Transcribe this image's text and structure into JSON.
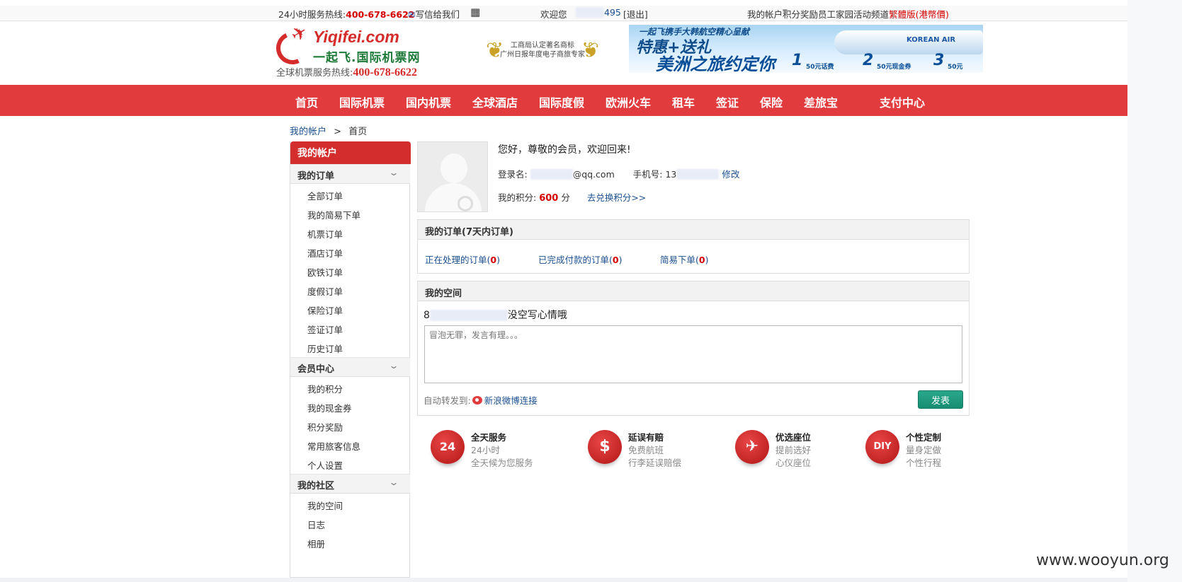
{
  "topbar": {
    "hotline_label": "24小时服务热线:",
    "hotline_number": "400-678-6622",
    "mail_link": "写信给我们",
    "welcome": "欢迎您",
    "username_tail": "495",
    "logout": "[退出]",
    "links": [
      "我的帐户",
      "积分奖励",
      "员工家园",
      "活动频道"
    ],
    "traditional": "繁體版(港幣價)"
  },
  "header": {
    "brand": "Yiqifei.com",
    "brand_sub": "一起飞.国际机票网",
    "hotline_label": "全球机票服务热线:",
    "hotline_number": "400-678-6622",
    "award_line1": "工商局认定著名商标",
    "award_line2": "广州日报年度电子商旅专家",
    "banner": {
      "line1": "一起飞携手大韩航空精心呈献",
      "line2": "特惠+送礼",
      "line3": "美洲之旅约定你",
      "airline": "KOREAN AIR",
      "coupons": [
        "50元话费",
        "50元现金券",
        "50元"
      ]
    }
  },
  "nav": {
    "items": [
      "首页",
      "国际机票",
      "国内机票",
      "全球酒店",
      "国际度假",
      "欧洲火车",
      "租车",
      "签证",
      "保险",
      "差旅宝",
      "支付中心"
    ]
  },
  "breadcrumb": {
    "root": "我的帐户",
    "sep": ">",
    "current": "首页"
  },
  "sidebar": {
    "title": "我的帐户",
    "sections": [
      {
        "label": "我的订单",
        "items": [
          "全部订单",
          "我的简易下单",
          "机票订单",
          "酒店订单",
          "欧铁订单",
          "度假订单",
          "保险订单",
          "签证订单",
          "历史订单"
        ]
      },
      {
        "label": "会员中心",
        "items": [
          "我的积分",
          "我的现金券",
          "积分奖励",
          "常用旅客信息",
          "个人设置"
        ]
      },
      {
        "label": "我的社区",
        "items": [
          "我的空间",
          "日志",
          "相册"
        ]
      }
    ]
  },
  "profile": {
    "greeting": "您好，尊敬的会员，欢迎回来!",
    "login_label": "登录名:",
    "login_value": "@qq.com",
    "phone_label": "手机号:",
    "phone_value": "13",
    "edit_link": "修改",
    "points_label": "我的积分:",
    "points_value": "600",
    "points_unit": "分",
    "exchange_link": "去兑换积分>>"
  },
  "orders": {
    "title": "我的订单(7天内订单)",
    "items": [
      {
        "label": "正在处理的订单",
        "count": "0"
      },
      {
        "label": "已完成付款的订单",
        "count": "0"
      },
      {
        "label": "简易下单",
        "count": "0"
      }
    ]
  },
  "space": {
    "title": "我的空间",
    "status_prefix": "8",
    "status_text": "没空写心情哦",
    "placeholder": "冒泡无罪，发言有理。。。",
    "forward_label": "自动转发到:",
    "weibo_link": "新浪微博连接",
    "submit": "发表"
  },
  "features": [
    {
      "icon": "24",
      "title": "全天服务",
      "line1": "24小时",
      "line2": "全天候为您服务"
    },
    {
      "icon": "$",
      "title": "延误有赔",
      "line1": "免费航班",
      "line2": "行李延误赔偿"
    },
    {
      "icon": "✈",
      "title": "优选座位",
      "line1": "提前选好",
      "line2": "心仪座位"
    },
    {
      "icon": "DIY",
      "title": "个性定制",
      "line1": "量身定做",
      "line2": "个性行程"
    }
  ],
  "watermark": "www.wooyun.org",
  "colors": {
    "brand_red": "#e23b3d",
    "link_blue": "#1a4f8f",
    "submit_green": "#1f9a7e"
  }
}
